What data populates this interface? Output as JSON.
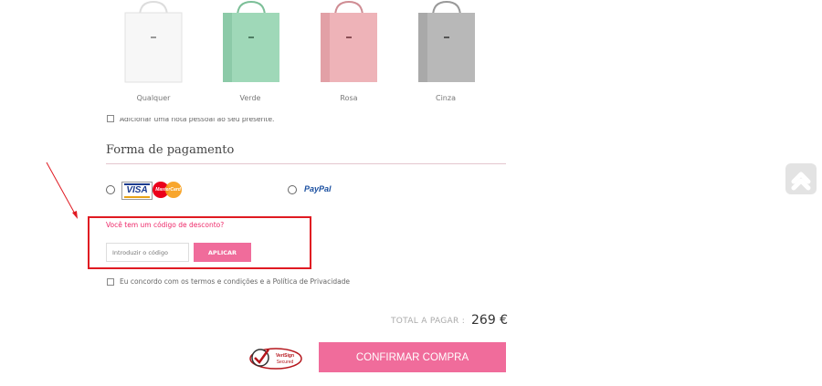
{
  "gift_bags": [
    {
      "label": "Qualquer",
      "color": "#f4f4f4"
    },
    {
      "label": "Verde",
      "color": "#9fd8b8"
    },
    {
      "label": "Rosa",
      "color": "#eeb3b8"
    },
    {
      "label": "Cinza",
      "color": "#b8b8b8"
    }
  ],
  "gift_note": {
    "label": "Adicionar uma nota pessoal ao seu presente."
  },
  "payment": {
    "title": "Forma de pagamento",
    "card_logos": [
      "VISA",
      "MasterCard"
    ],
    "paypal_label": "PayPal"
  },
  "discount": {
    "question": "Você tem um código de desconto?",
    "input_placeholder": "Introduzir o código",
    "apply_label": "APLICAR"
  },
  "terms": {
    "label": "Eu concordo com os termos e condições e a Política de Privacidade"
  },
  "total": {
    "label": "TOTAL A PAGAR :",
    "value": "269 €"
  },
  "verisign": {
    "label": "VeriSign Secured"
  },
  "confirm": {
    "label": "CONFIRMAR COMPRA"
  },
  "icons": {
    "scroll_top": "chevron-up-icon"
  },
  "colors": {
    "accent": "#f06c9b",
    "annotation": "#e01a22"
  }
}
